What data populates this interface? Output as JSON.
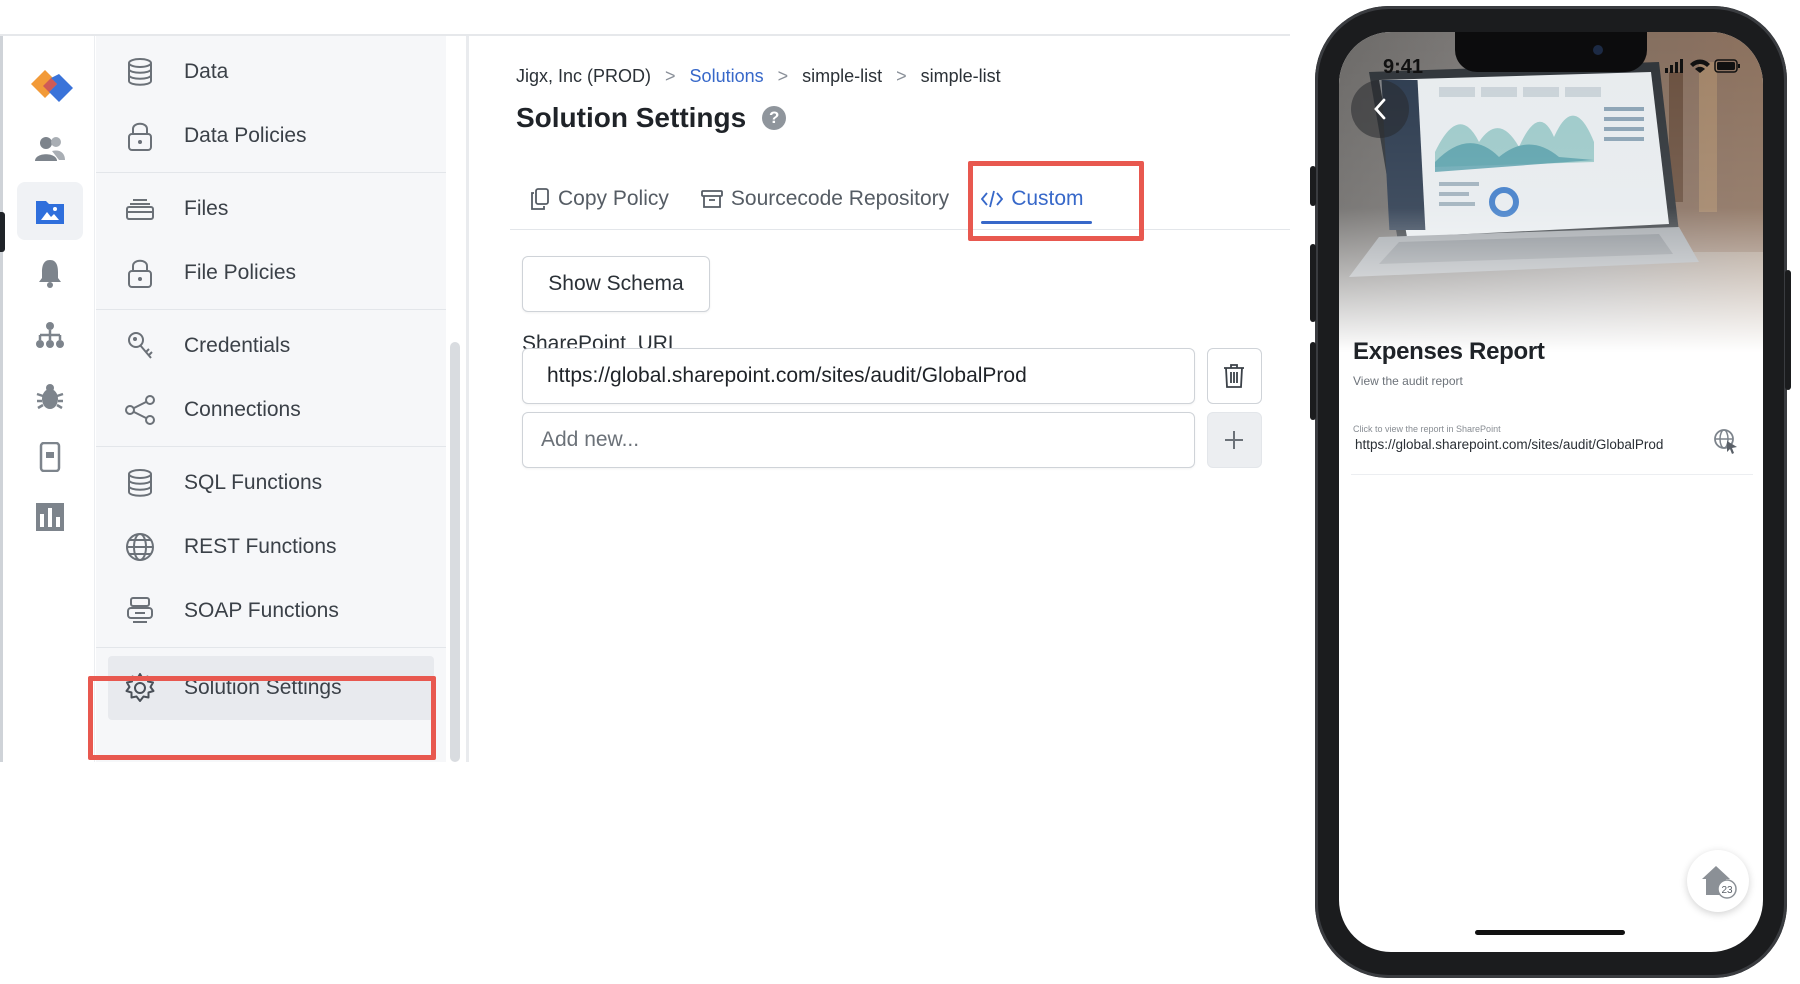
{
  "breadcrumb": {
    "org": "Jigx, Inc (PROD)",
    "solutions": "Solutions",
    "solution": "simple-list",
    "current": "simple-list",
    "separator": ">"
  },
  "page": {
    "title": "Solution Settings",
    "help": "?"
  },
  "sidebar": {
    "groups": [
      {
        "items": [
          {
            "label": "Data",
            "icon": "database-icon"
          },
          {
            "label": "Data Policies",
            "icon": "lock-icon"
          }
        ]
      },
      {
        "items": [
          {
            "label": "Files",
            "icon": "files-icon"
          },
          {
            "label": "File Policies",
            "icon": "lock-icon"
          }
        ]
      },
      {
        "items": [
          {
            "label": "Credentials",
            "icon": "key-icon"
          },
          {
            "label": "Connections",
            "icon": "share-icon"
          }
        ]
      },
      {
        "items": [
          {
            "label": "SQL Functions",
            "icon": "database-icon"
          },
          {
            "label": "REST Functions",
            "icon": "globe-icon"
          },
          {
            "label": "SOAP Functions",
            "icon": "soap-icon"
          }
        ]
      },
      {
        "items": [
          {
            "label": "Solution Settings",
            "icon": "gear-icon",
            "selected": true
          }
        ]
      }
    ]
  },
  "rail": {
    "items": [
      "users-icon",
      "solutions-icon",
      "notifications-icon",
      "hierarchy-icon",
      "bug-icon",
      "mobile-icon",
      "dashboard-icon"
    ],
    "active": "solutions-icon"
  },
  "tabs": [
    {
      "label": "Copy Policy",
      "icon": "copy-icon"
    },
    {
      "label": "Sourcecode Repository",
      "icon": "archive-icon"
    },
    {
      "label": "Custom",
      "icon": "code-icon",
      "active": true
    }
  ],
  "custom": {
    "show_schema": "Show Schema",
    "field_label": "SharePoint_URL",
    "field_value": "https://global.sharepoint.com/sites/audit/GlobalProd",
    "add_placeholder": "Add new..."
  },
  "phone": {
    "time": "9:41",
    "report_title": "Expenses Report",
    "report_subtitle": "View the audit report",
    "link_caption": "Click to view the report in SharePoint",
    "link_url": "https://global.sharepoint.com/sites/audit/GlobalProd",
    "badge": "23"
  },
  "colors": {
    "accent": "#3768c9",
    "highlight": "#e8584f",
    "logo_orange": "#f29a38",
    "logo_blue": "#3a73d9"
  }
}
